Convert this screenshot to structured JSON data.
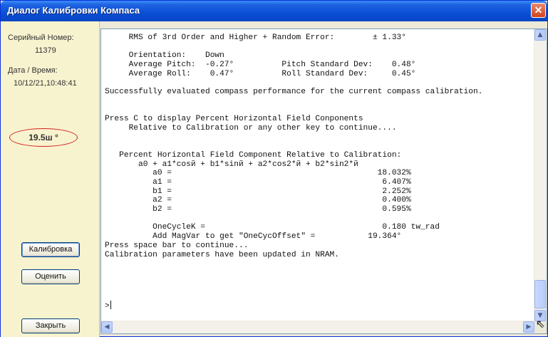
{
  "window": {
    "title": "Диалог Калибровки Компаса",
    "close_glyph": "✕"
  },
  "sidebar": {
    "serial_label": "Серийный Номер:",
    "serial_value": "11379",
    "datetime_label": "Дата / Время:",
    "datetime_value": "10/12/21,10:48:41",
    "heading_value": "19.5ш °",
    "buttons": {
      "calibrate": "Калибровка",
      "evaluate": "Оценить",
      "close": "Закрыть"
    }
  },
  "console": {
    "lines": [
      "     RMS of 3rd Order and Higher + Random Error:        ± 1.33°",
      "",
      "     Orientation:    Down",
      "     Average Pitch:  -0.27°          Pitch Standard Dev:    0.48°",
      "     Average Roll:    0.47°          Roll Standard Dev:     0.45°",
      "",
      "Successfully evaluated compass performance for the current compass calibration.",
      "",
      "",
      "Press C to display Percent Horizontal Field Conponents",
      "     Relative to Calibration or any other key to continue....",
      "",
      "",
      "   Percent Horizontal Field Component Relative to Calibration:",
      "       a0 + a1*cosй + b1*sinй + a2*cos2*й + b2*sin2*й",
      "          a0 =                                           18.032%",
      "          a1 =                                            6.407%",
      "          b1 =                                            2.252%",
      "          a2 =                                            0.400%",
      "          b2 =                                            0.595%",
      "",
      "          OneCycleK =                                     0.180 tw_rad",
      "          Add MagVar to get \"OneCycOffset\" =           19.364°",
      "Press space bar to continue...",
      "Calibration parameters have been updated in NRAM."
    ],
    "prompt": ">"
  },
  "scrollbars": {
    "up_glyph": "▲",
    "down_glyph": "▼",
    "left_glyph": "◀",
    "right_glyph": "▶"
  },
  "colors": {
    "titlebar": "#0a4fd6",
    "sidebar_bg": "#f8f3cf",
    "heading_ring": "#d21f1f"
  }
}
